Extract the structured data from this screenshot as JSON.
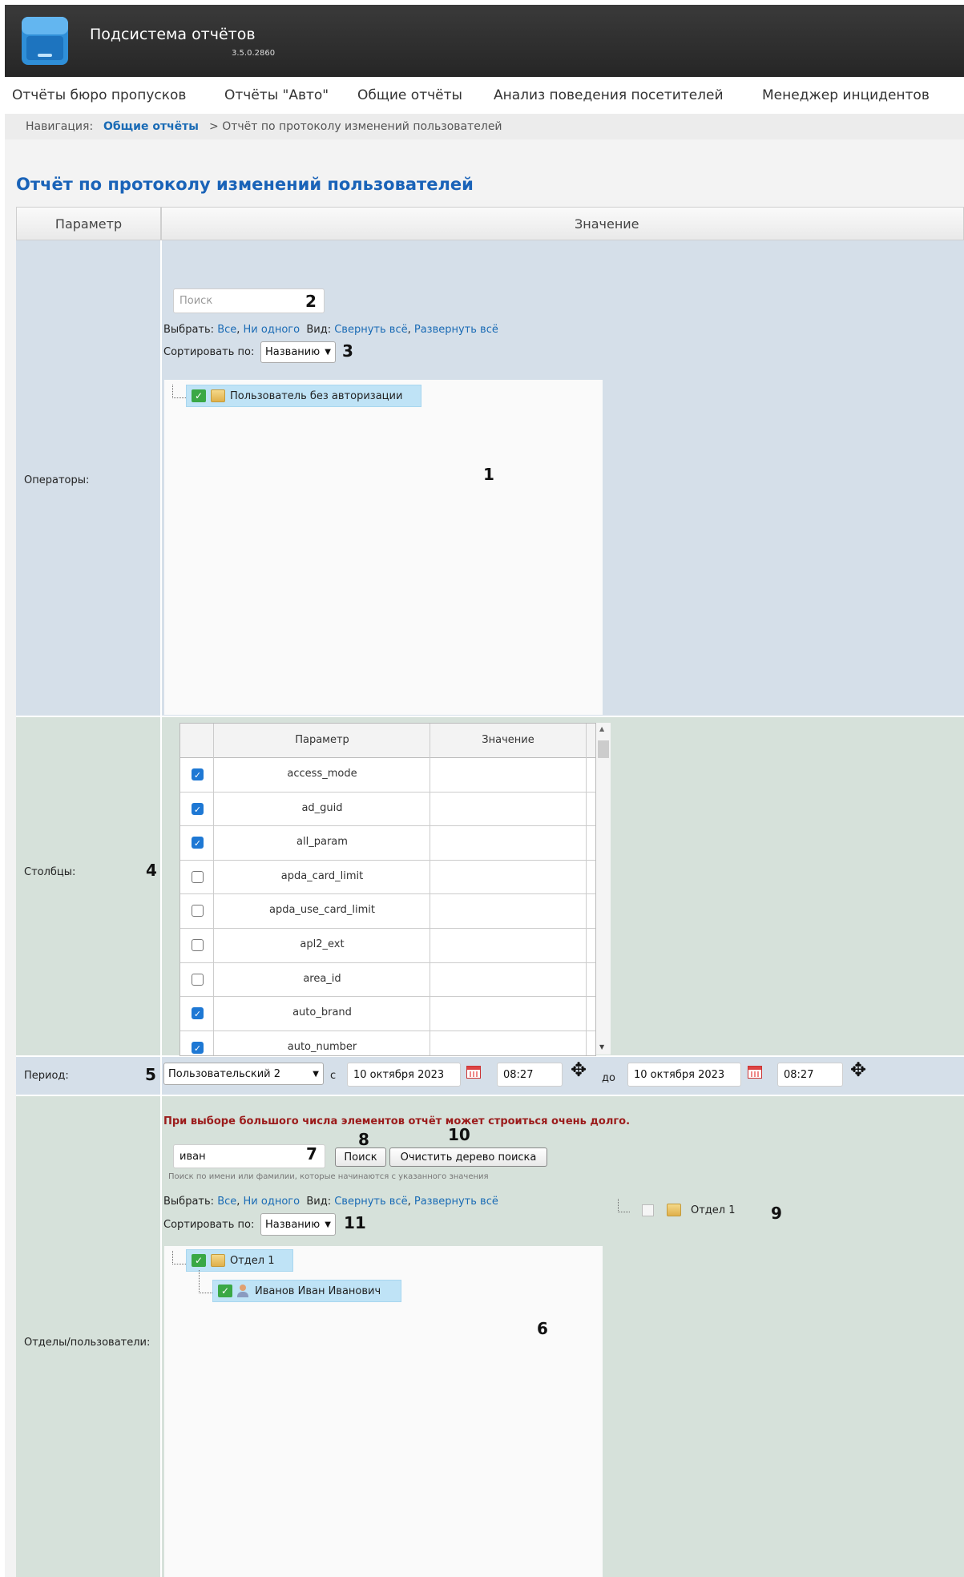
{
  "app": {
    "title": "Подсистема отчётов",
    "version": "3.5.0.2860"
  },
  "menu": [
    "Отчёты бюро пропусков",
    "Отчёты \"Авто\"",
    "Общие отчёты",
    "Анализ поведения посетителей",
    "Менеджер инцидентов"
  ],
  "breadcrumb": {
    "label": "Навигация:",
    "link": "Общие отчёты",
    "separator": ">",
    "current": "Отчёт по протоколу изменений пользователей"
  },
  "page_title": "Отчёт по протоколу изменений пользователей",
  "table": {
    "col_param": "Параметр",
    "col_value": "Значение"
  },
  "operators": {
    "label": "Операторы:",
    "search_placeholder": "Поиск",
    "select_label": "Выбрать:",
    "select_all": "Все",
    "select_none": "Ни одного",
    "view_label": "Вид:",
    "collapse": "Свернуть всё",
    "expand": "Развернуть всё",
    "sort_label": "Сортировать по:",
    "sort_value": "Названию",
    "tree_item": "Пользователь без авторизации",
    "callouts": {
      "tree": "1",
      "search": "2",
      "sort": "3"
    }
  },
  "columns": {
    "label": "Столбцы:",
    "callout": "4",
    "header_param": "Параметр",
    "header_value": "Значение",
    "rows": [
      {
        "name": "access_mode",
        "checked": true
      },
      {
        "name": "ad_guid",
        "checked": true
      },
      {
        "name": "all_param",
        "checked": true
      },
      {
        "name": "apda_card_limit",
        "checked": false
      },
      {
        "name": "apda_use_card_limit",
        "checked": false
      },
      {
        "name": "apl2_ext",
        "checked": false
      },
      {
        "name": "area_id",
        "checked": false
      },
      {
        "name": "auto_brand",
        "checked": true
      },
      {
        "name": "auto_number",
        "checked": true
      }
    ]
  },
  "period": {
    "label": "Период:",
    "callout": "5",
    "type": "Пользовательский 2",
    "from_label": "с",
    "from_date": "10 октября 2023",
    "from_time": "08:27",
    "to_label": "до",
    "to_date": "10 октября 2023",
    "to_time": "08:27"
  },
  "departments": {
    "label": "Отделы/пользователи:",
    "warning": "При выборе большого числа элементов отчёт может строиться очень долго.",
    "search_value": "иван",
    "search_button": "Поиск",
    "clear_button": "Очистить дерево поиска",
    "hint": "Поиск по имени или фамилии, которые начинаются с указанного значения",
    "select_label": "Выбрать:",
    "select_all": "Все",
    "select_none": "Ни одного",
    "view_label": "Вид:",
    "collapse": "Свернуть всё",
    "expand": "Развернуть всё",
    "sort_label": "Сортировать по:",
    "sort_value": "Названию",
    "tree_dept": "Отдел 1",
    "tree_user": "Иванов Иван Иванович",
    "side_dept": "Отдел 1",
    "callouts": {
      "tree": "6",
      "search_input": "7",
      "search_button": "8",
      "side_tree": "9",
      "clear_button": "10",
      "sort": "11"
    }
  },
  "colors": {
    "title_blue": "#1a63b8",
    "link_blue": "#1a6bb5",
    "warning_red": "#9b1b1b",
    "selected_node": "#bfe3f6",
    "check_blue": "#1e78d4"
  }
}
